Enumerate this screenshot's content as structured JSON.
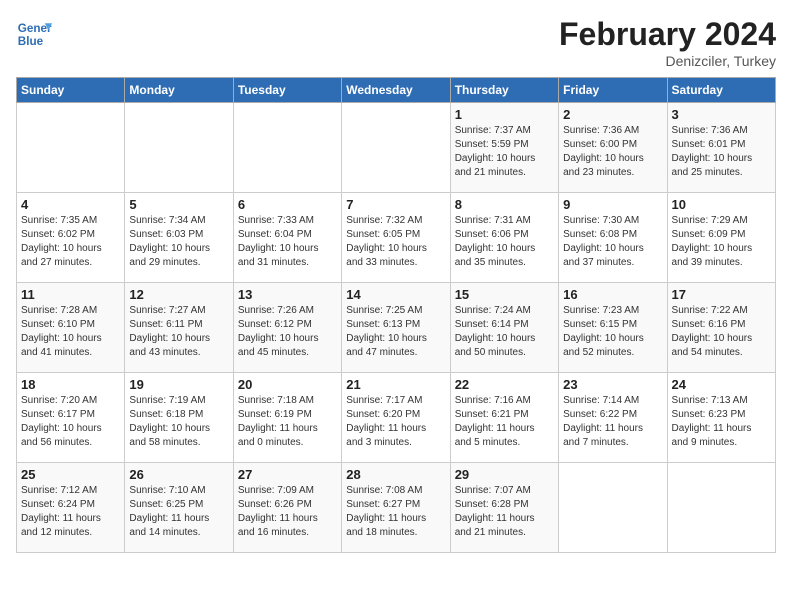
{
  "header": {
    "logo_line1": "General",
    "logo_line2": "Blue",
    "month": "February 2024",
    "location": "Denizciler, Turkey"
  },
  "weekdays": [
    "Sunday",
    "Monday",
    "Tuesday",
    "Wednesday",
    "Thursday",
    "Friday",
    "Saturday"
  ],
  "weeks": [
    [
      {
        "day": "",
        "info": ""
      },
      {
        "day": "",
        "info": ""
      },
      {
        "day": "",
        "info": ""
      },
      {
        "day": "",
        "info": ""
      },
      {
        "day": "1",
        "info": "Sunrise: 7:37 AM\nSunset: 5:59 PM\nDaylight: 10 hours\nand 21 minutes."
      },
      {
        "day": "2",
        "info": "Sunrise: 7:36 AM\nSunset: 6:00 PM\nDaylight: 10 hours\nand 23 minutes."
      },
      {
        "day": "3",
        "info": "Sunrise: 7:36 AM\nSunset: 6:01 PM\nDaylight: 10 hours\nand 25 minutes."
      }
    ],
    [
      {
        "day": "4",
        "info": "Sunrise: 7:35 AM\nSunset: 6:02 PM\nDaylight: 10 hours\nand 27 minutes."
      },
      {
        "day": "5",
        "info": "Sunrise: 7:34 AM\nSunset: 6:03 PM\nDaylight: 10 hours\nand 29 minutes."
      },
      {
        "day": "6",
        "info": "Sunrise: 7:33 AM\nSunset: 6:04 PM\nDaylight: 10 hours\nand 31 minutes."
      },
      {
        "day": "7",
        "info": "Sunrise: 7:32 AM\nSunset: 6:05 PM\nDaylight: 10 hours\nand 33 minutes."
      },
      {
        "day": "8",
        "info": "Sunrise: 7:31 AM\nSunset: 6:06 PM\nDaylight: 10 hours\nand 35 minutes."
      },
      {
        "day": "9",
        "info": "Sunrise: 7:30 AM\nSunset: 6:08 PM\nDaylight: 10 hours\nand 37 minutes."
      },
      {
        "day": "10",
        "info": "Sunrise: 7:29 AM\nSunset: 6:09 PM\nDaylight: 10 hours\nand 39 minutes."
      }
    ],
    [
      {
        "day": "11",
        "info": "Sunrise: 7:28 AM\nSunset: 6:10 PM\nDaylight: 10 hours\nand 41 minutes."
      },
      {
        "day": "12",
        "info": "Sunrise: 7:27 AM\nSunset: 6:11 PM\nDaylight: 10 hours\nand 43 minutes."
      },
      {
        "day": "13",
        "info": "Sunrise: 7:26 AM\nSunset: 6:12 PM\nDaylight: 10 hours\nand 45 minutes."
      },
      {
        "day": "14",
        "info": "Sunrise: 7:25 AM\nSunset: 6:13 PM\nDaylight: 10 hours\nand 47 minutes."
      },
      {
        "day": "15",
        "info": "Sunrise: 7:24 AM\nSunset: 6:14 PM\nDaylight: 10 hours\nand 50 minutes."
      },
      {
        "day": "16",
        "info": "Sunrise: 7:23 AM\nSunset: 6:15 PM\nDaylight: 10 hours\nand 52 minutes."
      },
      {
        "day": "17",
        "info": "Sunrise: 7:22 AM\nSunset: 6:16 PM\nDaylight: 10 hours\nand 54 minutes."
      }
    ],
    [
      {
        "day": "18",
        "info": "Sunrise: 7:20 AM\nSunset: 6:17 PM\nDaylight: 10 hours\nand 56 minutes."
      },
      {
        "day": "19",
        "info": "Sunrise: 7:19 AM\nSunset: 6:18 PM\nDaylight: 10 hours\nand 58 minutes."
      },
      {
        "day": "20",
        "info": "Sunrise: 7:18 AM\nSunset: 6:19 PM\nDaylight: 11 hours\nand 0 minutes."
      },
      {
        "day": "21",
        "info": "Sunrise: 7:17 AM\nSunset: 6:20 PM\nDaylight: 11 hours\nand 3 minutes."
      },
      {
        "day": "22",
        "info": "Sunrise: 7:16 AM\nSunset: 6:21 PM\nDaylight: 11 hours\nand 5 minutes."
      },
      {
        "day": "23",
        "info": "Sunrise: 7:14 AM\nSunset: 6:22 PM\nDaylight: 11 hours\nand 7 minutes."
      },
      {
        "day": "24",
        "info": "Sunrise: 7:13 AM\nSunset: 6:23 PM\nDaylight: 11 hours\nand 9 minutes."
      }
    ],
    [
      {
        "day": "25",
        "info": "Sunrise: 7:12 AM\nSunset: 6:24 PM\nDaylight: 11 hours\nand 12 minutes."
      },
      {
        "day": "26",
        "info": "Sunrise: 7:10 AM\nSunset: 6:25 PM\nDaylight: 11 hours\nand 14 minutes."
      },
      {
        "day": "27",
        "info": "Sunrise: 7:09 AM\nSunset: 6:26 PM\nDaylight: 11 hours\nand 16 minutes."
      },
      {
        "day": "28",
        "info": "Sunrise: 7:08 AM\nSunset: 6:27 PM\nDaylight: 11 hours\nand 18 minutes."
      },
      {
        "day": "29",
        "info": "Sunrise: 7:07 AM\nSunset: 6:28 PM\nDaylight: 11 hours\nand 21 minutes."
      },
      {
        "day": "",
        "info": ""
      },
      {
        "day": "",
        "info": ""
      }
    ]
  ]
}
